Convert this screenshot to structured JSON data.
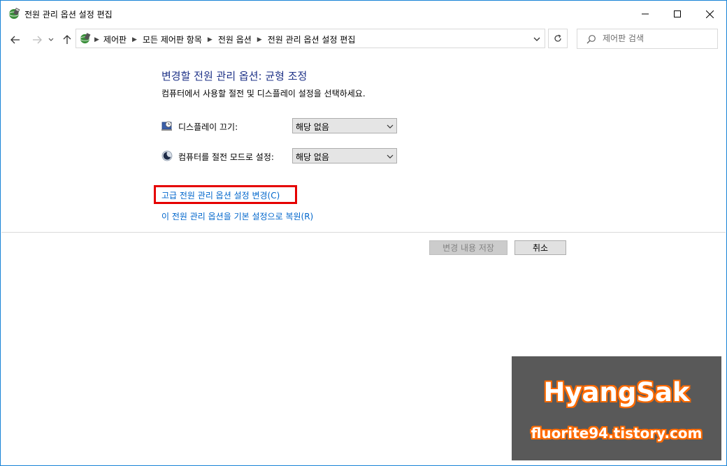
{
  "window": {
    "title": "전원 관리 옵션 설정 편집",
    "icon": "power-options-icon",
    "controls": {
      "minimize": "minimize-icon",
      "maximize": "maximize-icon",
      "close": "close-icon"
    }
  },
  "address_bar": {
    "icon": "control-panel-icon",
    "breadcrumbs": [
      "제어판",
      "모든 제어판 항목",
      "전원 옵션",
      "전원 관리 옵션 설정 편집"
    ]
  },
  "search": {
    "placeholder": "제어판 검색"
  },
  "content": {
    "heading": "변경할 전원 관리 옵션: 균형 조정",
    "description": "컴퓨터에서 사용할 절전 및 디스플레이 설정을 선택하세요.",
    "display_off": {
      "label": "디스플레이 끄기:",
      "value": "해당 없음",
      "icon": "display-clock-icon"
    },
    "sleep": {
      "label": "컴퓨터를 절전 모드로 설정:",
      "value": "해당 없음",
      "icon": "moon-icon"
    },
    "advanced_link": "고급 전원 관리 옵션 설정 변경(C)",
    "restore_link": "이 전원 관리 옵션을 기본 설정으로 복원(R)"
  },
  "buttons": {
    "save": "변경 내용 저장",
    "cancel": "취소"
  },
  "watermark": {
    "title": "HyangSak",
    "url": "fluorite94.tistory.com"
  },
  "colors": {
    "heading": "#1e3287",
    "link": "#0066cc",
    "highlight": "#e50000",
    "watermark_bg": "#595959",
    "watermark_outline": "#ff6a00"
  }
}
